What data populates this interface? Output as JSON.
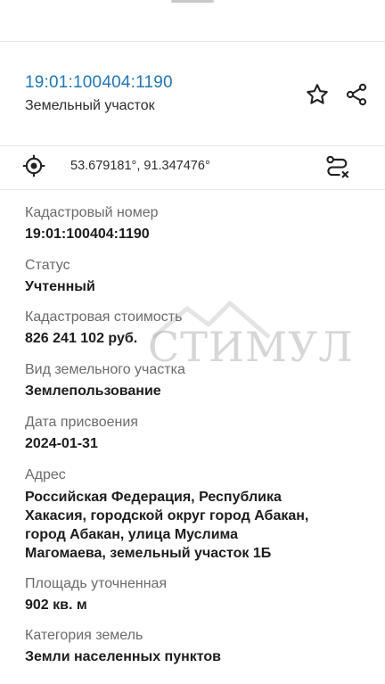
{
  "object": {
    "cadastral_link": "19:01:100404:1190",
    "type": "Земельный участок"
  },
  "icons": {
    "favorite": "star-icon",
    "share": "share-icon",
    "locate": "target-icon",
    "route": "route-icon"
  },
  "coordinates": "53.679181°, 91.347476°",
  "fields": [
    {
      "label": "Кадастровый номер",
      "value": "19:01:100404:1190"
    },
    {
      "label": "Статус",
      "value": "Учтенный"
    },
    {
      "label": "Кадастровая стоимость",
      "value": "826 241 102 руб."
    },
    {
      "label": "Вид земельного участка",
      "value": "Землепользование"
    },
    {
      "label": "Дата присвоения",
      "value": "2024-01-31"
    },
    {
      "label": "Адрес",
      "value_lines": [
        "Российская Федерация, Республика",
        "Хакасия, городской округ город Абакан,",
        "город Абакан, улица Муслима",
        "Магомаева, земельный участок 1Б"
      ]
    },
    {
      "label": "Площадь уточненная",
      "value": "902 кв. м"
    },
    {
      "label": "Категория земель",
      "value": "Земли населенных пунктов"
    }
  ],
  "watermark": "СТИМУЛ",
  "colors": {
    "link": "#1f77b4",
    "label": "#6b6b6b",
    "value": "#1d1d1d"
  }
}
